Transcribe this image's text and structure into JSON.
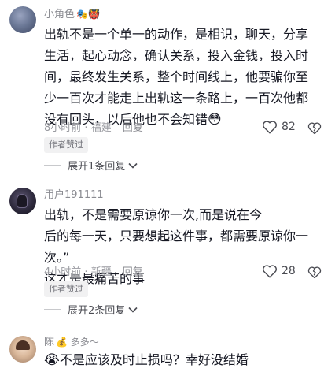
{
  "comments": [
    {
      "username": "小角色",
      "name_decoration": "🎭👹",
      "text": "出轨不是一个单一的动作，是相识，聊天，分享生活，起心动念，确认关系，投入金钱，投入时间，最终发生关系，整个时间线上，他要骗你至少一百次才能走上出轨这一条路上，一百次他都没有回头，以后他也不会知错",
      "text_emoji": "😳",
      "time": "8小时前",
      "location": "福建",
      "reply_label": "回复",
      "author_badge": "作者赞过",
      "likes": "82",
      "expand_label": "展开1条回复"
    },
    {
      "username": "用户191111",
      "name_decoration": "",
      "text": "出轨，不是需要原谅你一次,而是说在今\n后的每一天，只要想起这件事，都需要原谅你一次。”\n这才是最痛苦的事",
      "text_emoji": "",
      "time": "4小时前",
      "location": "新疆",
      "reply_label": "回复",
      "author_badge": "作者赞过",
      "likes": "28",
      "expand_label": "展开2条回复"
    },
    {
      "username": "陈",
      "name_decoration": "💰 多多～",
      "text": "不是应该及时止损吗？幸好没结婚",
      "text_emoji": "😭"
    }
  ],
  "icons": {
    "like": "heart-outline-icon",
    "dislike": "broken-heart-icon",
    "expand": "chevron-down-icon"
  }
}
